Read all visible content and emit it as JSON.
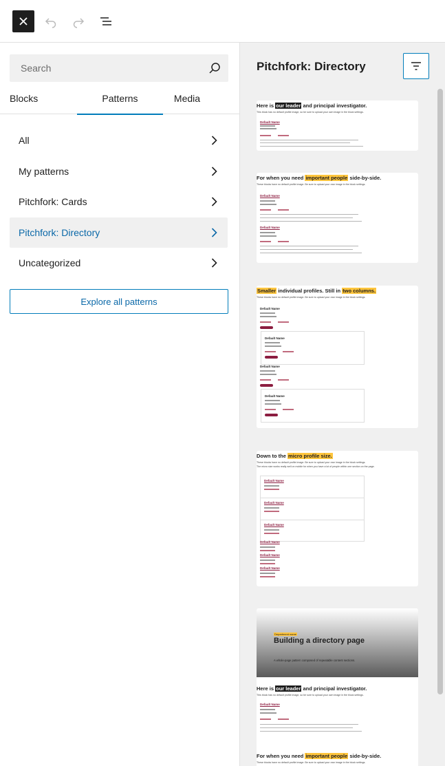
{
  "toolbar": {
    "close_icon": "close-icon",
    "undo_icon": "undo-icon",
    "redo_icon": "redo-icon",
    "list_view_icon": "list-view-icon"
  },
  "sidebar": {
    "search": {
      "placeholder": "Search",
      "value": ""
    },
    "tabs": [
      {
        "label": "Blocks"
      },
      {
        "label": "Patterns",
        "active": true
      },
      {
        "label": "Media"
      }
    ],
    "categories": [
      {
        "label": "All"
      },
      {
        "label": "My patterns"
      },
      {
        "label": "Pitchfork: Cards"
      },
      {
        "label": "Pitchfork: Directory",
        "active": true
      },
      {
        "label": "Uncategorized"
      }
    ],
    "explore_label": "Explore all patterns"
  },
  "preview_panel": {
    "title": "Pitchfork: Directory",
    "filter_icon": "filter-icon",
    "accent_color": "#007cba",
    "highlight_color": "#ffc53d",
    "brand_color": "#8c1d40",
    "cards": [
      {
        "heading_pre": "Here is ",
        "heading_hl": "our leader",
        "heading_post": " and principal investigator.",
        "sub": "This block has no default profile image, so be sure to upload your own image in the block settings.",
        "profile_name": "Default Name"
      },
      {
        "heading_pre": "For when you need ",
        "heading_hl": "important people",
        "heading_post": " side-by-side.",
        "sub": "These blocks have no default profile image. Be sure to upload your own image in the block settings.",
        "profile_names": [
          "Default Name",
          "Default Name"
        ]
      },
      {
        "heading_hl1": "Smaller",
        "heading_mid": " individual profiles. Still in ",
        "heading_hl2": "two columns.",
        "sub": "These blocks have no default profile image. Be sure to upload your own image in the block settings.",
        "profile_names": [
          "Default Name",
          "Default Name",
          "Default Name",
          "Default Name"
        ]
      },
      {
        "heading_pre": "Down to the ",
        "heading_hl": "micro profile size.",
        "sub": "These blocks have no default profile image. Be sure to upload your own image in the block settings.",
        "sub2": "The micro size works really well on mobile for when you have a lot of people within one section on the page.",
        "profile_names": [
          "Default Name",
          "Default Name",
          "Default Name",
          "Default Name",
          "Default Name",
          "Default Name"
        ]
      },
      {
        "hero_tag": "Department name",
        "hero_title": "Building a directory page",
        "hero_sub": "A whole-page pattern composed of repeatable content sections.",
        "heading_pre": "Here is ",
        "heading_hl": "our leader",
        "heading_post": " and principal investigator.",
        "sub": "This block has no default profile image, so be sure to upload your own image in the block settings.",
        "profile_name": "Default Name",
        "heading2_pre": "For when you need ",
        "heading2_hl": "important people",
        "heading2_post": " side-by-side.",
        "sub2": "These blocks have no default profile image. Be sure to upload your own image in the block settings."
      }
    ]
  }
}
